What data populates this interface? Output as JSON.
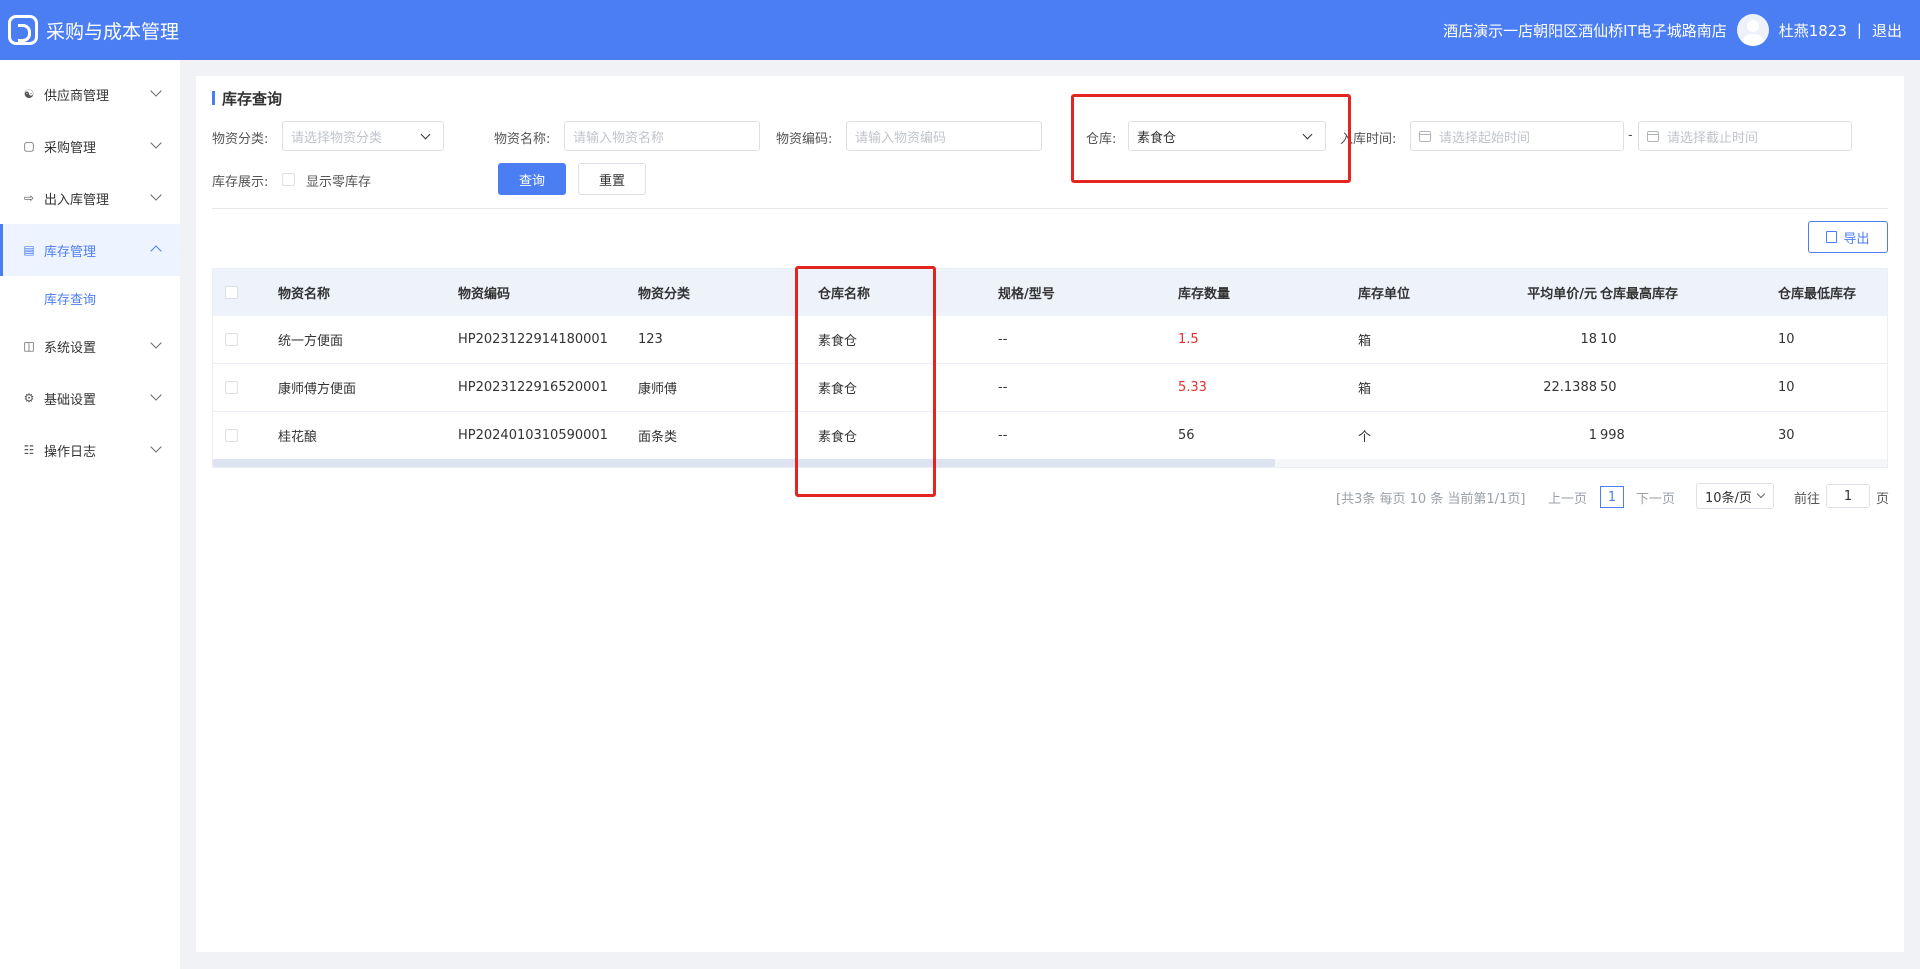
{
  "header": {
    "app_title": "采购与成本管理",
    "store_name": "酒店演示一店朝阳区酒仙桥IT电子城路南店",
    "user_name": "杜燕1823",
    "separator": "|",
    "logout_label": "退出"
  },
  "sidebar": {
    "items": [
      {
        "label": "供应商管理",
        "icon": "supplier-icon"
      },
      {
        "label": "采购管理",
        "icon": "purchase-icon"
      },
      {
        "label": "出入库管理",
        "icon": "inout-icon"
      },
      {
        "label": "库存管理",
        "icon": "inventory-icon",
        "active": true
      },
      {
        "label": "系统设置",
        "icon": "system-icon"
      },
      {
        "label": "基础设置",
        "icon": "gear-icon"
      },
      {
        "label": "操作日志",
        "icon": "log-icon"
      }
    ],
    "submenu": {
      "label": "库存查询"
    }
  },
  "page": {
    "title": "库存查询"
  },
  "filters": {
    "category": {
      "label": "物资分类:",
      "placeholder": "请选择物资分类"
    },
    "name": {
      "label": "物资名称:",
      "placeholder": "请输入物资名称"
    },
    "code": {
      "label": "物资编码:",
      "placeholder": "请输入物资编码"
    },
    "warehouse": {
      "label": "仓库:",
      "value": "素食仓"
    },
    "in_time": {
      "label": "入库时间:",
      "start_placeholder": "请选择起始时间",
      "separator": "-",
      "end_placeholder": "请选择截止时间"
    },
    "display": {
      "label": "库存展示:",
      "checkbox_label": "显示零库存"
    },
    "query_button": "查询",
    "reset_button": "重置"
  },
  "toolbar": {
    "export_label": "导出"
  },
  "table": {
    "columns": [
      "物资名称",
      "物资编码",
      "物资分类",
      "仓库名称",
      "规格/型号",
      "库存数量",
      "库存单位",
      "平均单价/元",
      "仓库最高库存",
      "仓库最低库存"
    ],
    "rows": [
      {
        "name": "统一方便面",
        "code": "HP2023122914180001",
        "category": "123",
        "warehouse": "素食仓",
        "spec": "--",
        "qty": "1.5",
        "unit": "箱",
        "price": "18",
        "max": "10",
        "min": "10"
      },
      {
        "name": "康师傅方便面",
        "code": "HP2023122916520001",
        "category": "康师傅",
        "warehouse": "素食仓",
        "spec": "--",
        "qty": "5.33",
        "unit": "箱",
        "price": "22.1388",
        "max": "50",
        "min": "10"
      },
      {
        "name": "桂花酿",
        "code": "HP2024010310590001",
        "category": "面条类",
        "warehouse": "素食仓",
        "spec": "--",
        "qty": "56",
        "unit": "个",
        "price": "1",
        "max": "998",
        "min": "30"
      }
    ]
  },
  "pagination": {
    "summary": "[共3条 每页 10 条 当前第1/1页]",
    "prev": "上一页",
    "current_page": "1",
    "next": "下一页",
    "page_size": "10条/页",
    "goto_label": "前往",
    "goto_value": "1",
    "page_suffix": "页"
  },
  "colors": {
    "accent": "#4c7ef3",
    "low_stock": "#e0302d",
    "annotation": "#e32520"
  }
}
